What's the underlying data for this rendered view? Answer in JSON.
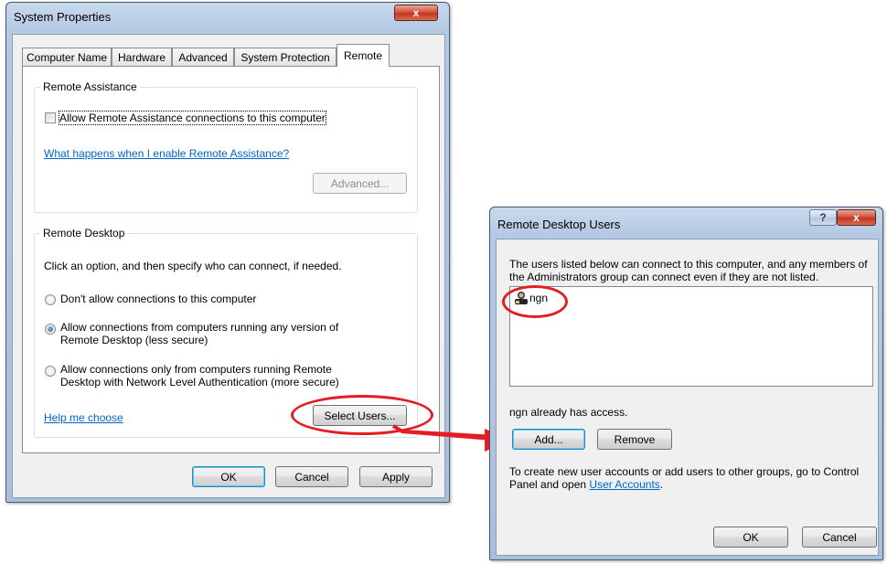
{
  "colors": {
    "annotation": "#e41d23",
    "link": "#0066cc",
    "titlebar": "#b4c9e3"
  },
  "system_properties": {
    "title": "System Properties",
    "close_glyph": "x",
    "tabs": [
      "Computer Name",
      "Hardware",
      "Advanced",
      "System Protection",
      "Remote"
    ],
    "active_tab": "Remote",
    "remote_assistance": {
      "legend": "Remote Assistance",
      "checkbox_label": "Allow Remote Assistance connections to this computer",
      "checked": false,
      "help_link": "What happens when I enable Remote Assistance?",
      "advanced_button": "Advanced..."
    },
    "remote_desktop": {
      "legend": "Remote Desktop",
      "instruction": "Click an option, and then specify who can connect, if needed.",
      "options": [
        {
          "line1": "Don't allow connections to this computer",
          "line2": "",
          "selected": false
        },
        {
          "line1": "Allow connections from computers running any version of",
          "line2": "Remote Desktop (less secure)",
          "selected": true
        },
        {
          "line1": "Allow connections only from computers running Remote",
          "line2": "Desktop with Network Level Authentication (more secure)",
          "selected": false
        }
      ],
      "help_link": "Help me choose",
      "select_users_button": "Select Users..."
    },
    "buttons": {
      "ok": "OK",
      "cancel": "Cancel",
      "apply": "Apply"
    }
  },
  "remote_desktop_users": {
    "title": "Remote Desktop Users",
    "help_glyph": "?",
    "close_glyph": "x",
    "description_line1": "The users listed below can connect to this computer, and any members of",
    "description_line2": "the Administrators group can connect even if they are not listed.",
    "users": [
      {
        "name": "ngn",
        "icon": "user-icon"
      }
    ],
    "access_status": "ngn already has access.",
    "add_button": "Add...",
    "remove_button": "Remove",
    "info_line1": "To create new user accounts or add users to other groups, go to Control",
    "info_line2_prefix": "Panel and open ",
    "info_link": "User Accounts",
    "info_suffix": ".",
    "buttons": {
      "ok": "OK",
      "cancel": "Cancel"
    }
  }
}
